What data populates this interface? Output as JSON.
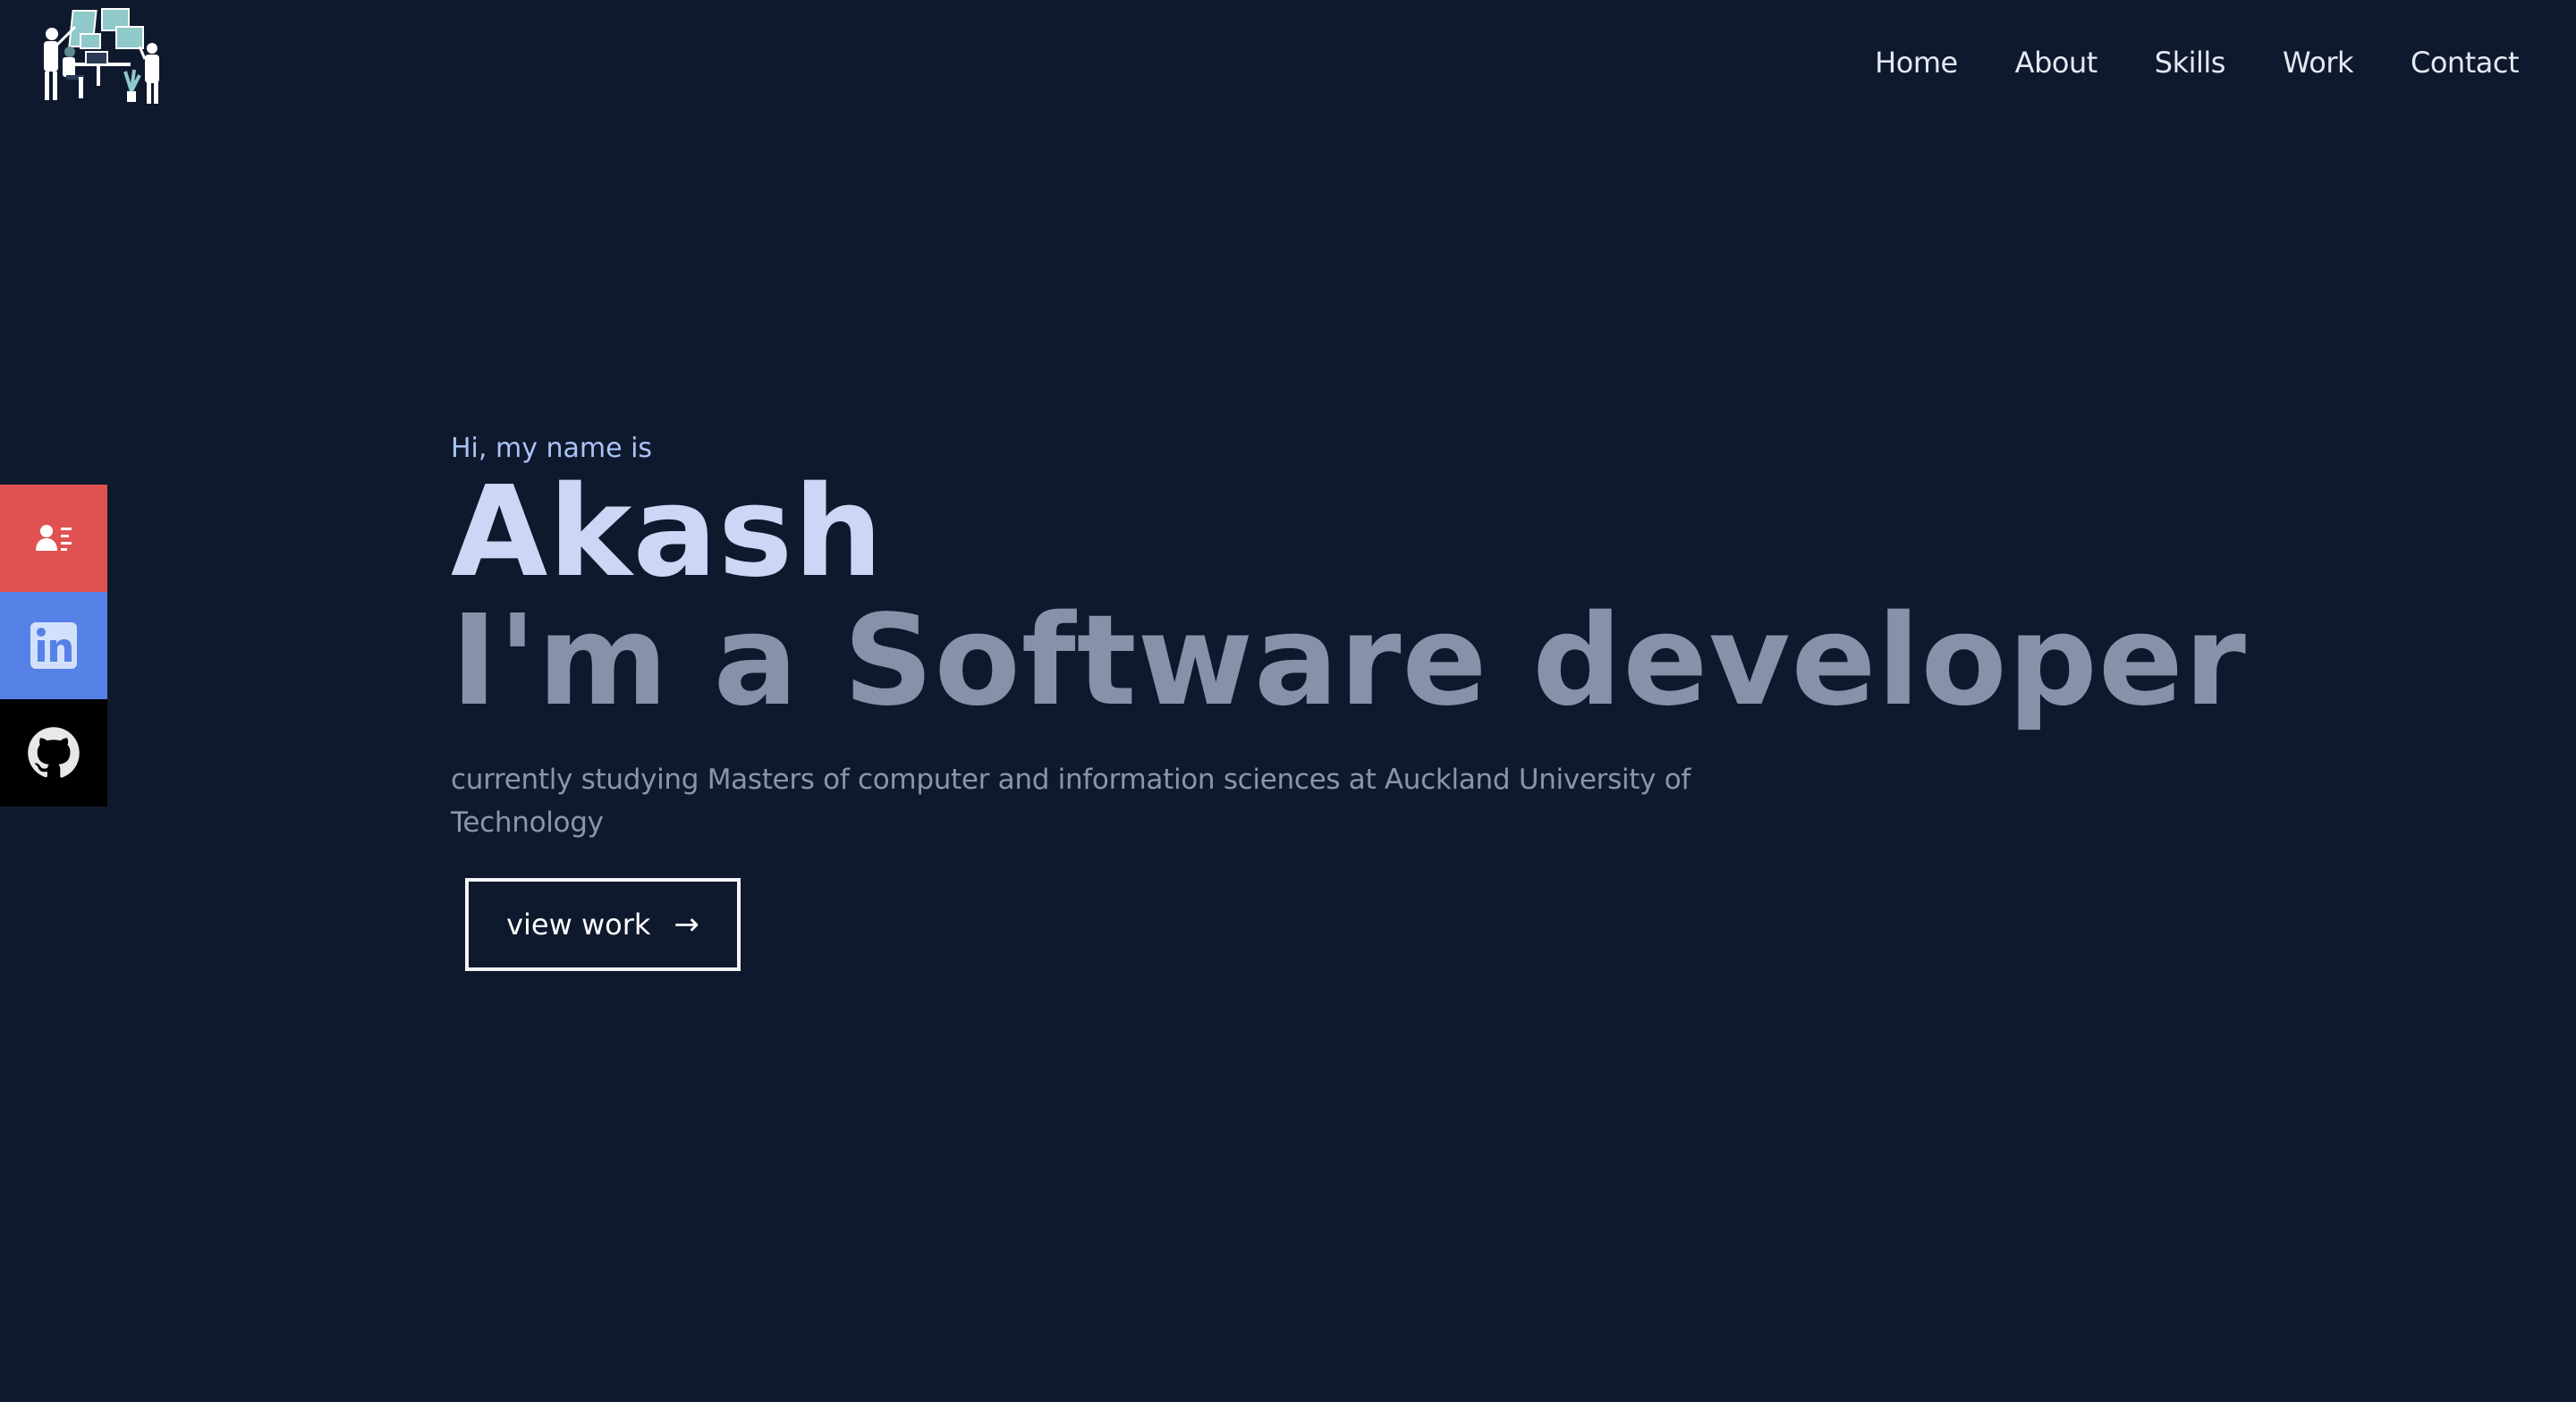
{
  "nav": {
    "items": [
      {
        "label": "Home"
      },
      {
        "label": "About"
      },
      {
        "label": "Skills"
      },
      {
        "label": "Work"
      },
      {
        "label": "Contact"
      }
    ]
  },
  "social": {
    "resume_icon": "resume-icon",
    "linkedin_icon": "linkedin-icon",
    "github_icon": "github-icon",
    "colors": {
      "resume": "#e05252",
      "linkedin": "#5681e6",
      "github": "#000000"
    }
  },
  "hero": {
    "greeting": "Hi, my name is",
    "name": "Akash",
    "role": "I'm a Software developer",
    "description": "currently studying Masters of computer and information sciences at Auckland University of Technology",
    "button_label": "view work",
    "button_icon": "→"
  },
  "colors": {
    "background": "#0f192d",
    "name": "#ccd6f5",
    "role": "#8890aa",
    "greeting": "#a9c3f5"
  }
}
